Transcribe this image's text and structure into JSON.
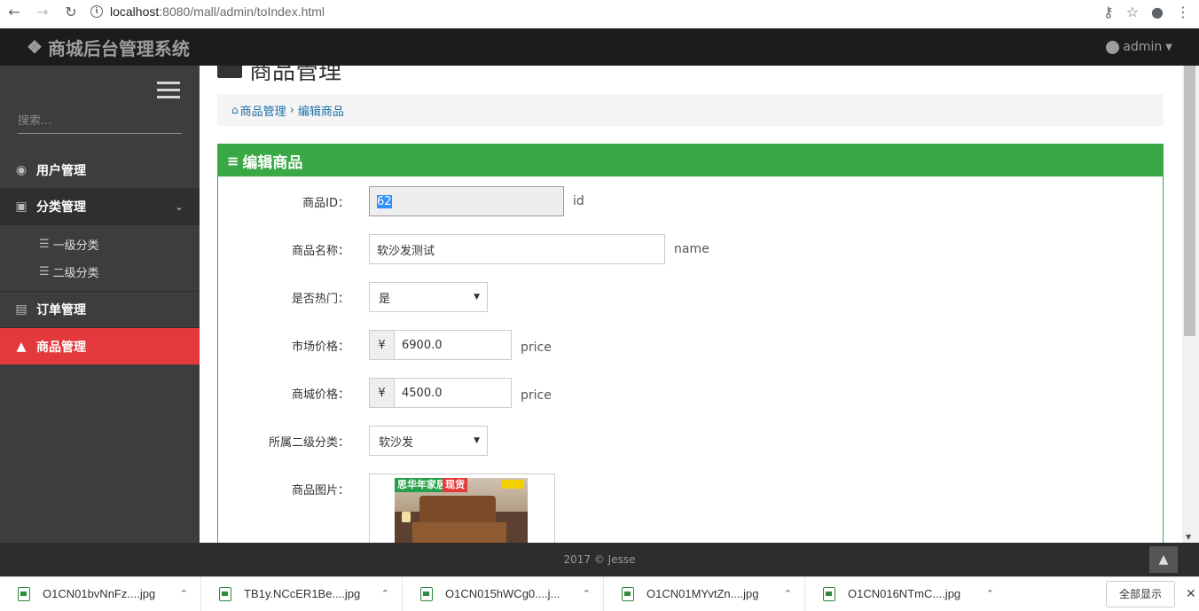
{
  "browser": {
    "url_host": "localhost",
    "url_path": ":8080/mall/admin/toIndex.html"
  },
  "header": {
    "brand": "商城后台管理系统",
    "user": "admin"
  },
  "sidebar": {
    "search_placeholder": "搜索...",
    "items": [
      {
        "label": "用户管理",
        "icon": "user-circle-icon"
      },
      {
        "label": "分类管理",
        "icon": "category-icon"
      },
      {
        "label": "订单管理",
        "icon": "file-icon"
      },
      {
        "label": "商品管理",
        "icon": "shopping-bag-icon"
      }
    ],
    "subitems": [
      {
        "label": "一级分类"
      },
      {
        "label": "二级分类"
      }
    ]
  },
  "main": {
    "page_title": "商品管理",
    "breadcrumb": {
      "parent": "商品管理",
      "current": "编辑商品"
    },
    "panel_title": "编辑商品",
    "form": {
      "id": {
        "label": "商品ID：",
        "value": "62",
        "hint": "id"
      },
      "name": {
        "label": "商品名称：",
        "value": "软沙发测试",
        "hint": "name"
      },
      "hot": {
        "label": "是否热门：",
        "value": "是"
      },
      "market_price": {
        "label": "市场价格：",
        "currency": "¥",
        "value": "6900.0",
        "hint": "price"
      },
      "shop_price": {
        "label": "商城价格：",
        "currency": "¥",
        "value": "4500.0",
        "hint": "price"
      },
      "category": {
        "label": "所属二级分类：",
        "value": "软沙发"
      },
      "image": {
        "label": "商品图片：",
        "banner_left": "思华年家居",
        "banner_right": "现货"
      }
    }
  },
  "footer": {
    "text": "2017 © Jesse"
  },
  "downloads": {
    "files": [
      "O1CN01bvNnFz....jpg",
      "TB1y.NCcER1Be....jpg",
      "O1CN015hWCg0....j...",
      "O1CN01MYvtZn....jpg",
      "O1CN016NTmC....jpg"
    ],
    "show_all": "全部显示"
  }
}
